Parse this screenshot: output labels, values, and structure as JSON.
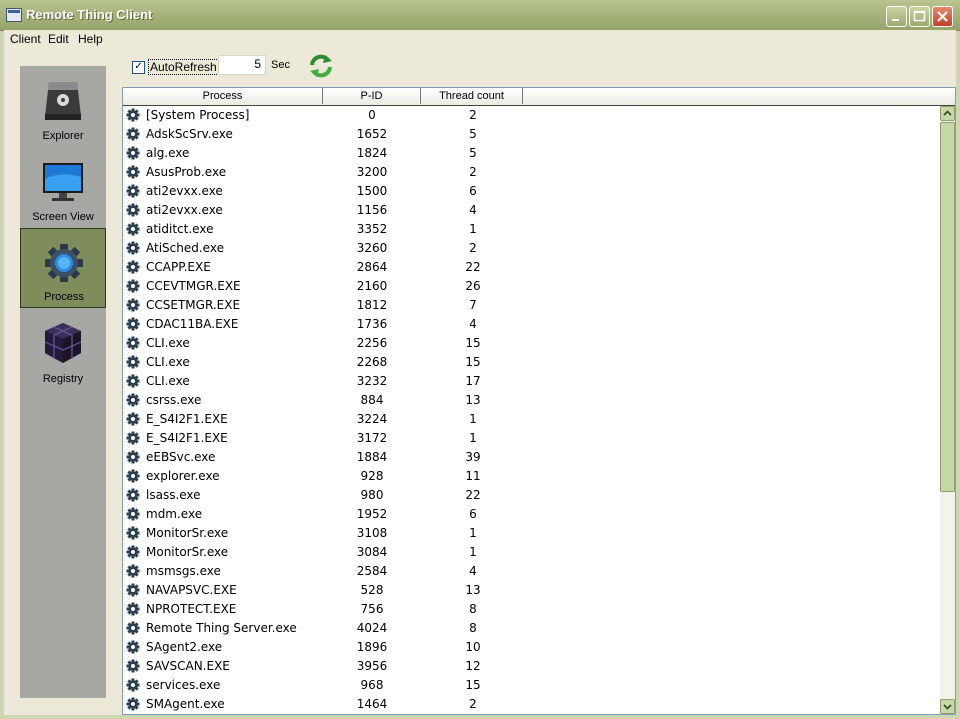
{
  "window": {
    "title": "Remote Thing Client"
  },
  "menu": {
    "items": [
      "Client",
      "Edit",
      "Help"
    ]
  },
  "sidebar": {
    "items": [
      {
        "label": "Explorer",
        "icon": "hard-drive-icon",
        "active": false
      },
      {
        "label": "Screen View",
        "icon": "monitor-icon",
        "active": false
      },
      {
        "label": "Process",
        "icon": "gear-icon",
        "active": true
      },
      {
        "label": "Registry",
        "icon": "registry-cube-icon",
        "active": false
      }
    ]
  },
  "toolbar": {
    "autorefresh_label": "AutoRefresh",
    "autorefresh_checked": true,
    "interval_value": "5",
    "interval_unit": "Sec",
    "refresh_icon": "refresh-icon"
  },
  "table": {
    "columns": [
      "Process",
      "P-ID",
      "Thread count"
    ],
    "rows": [
      [
        "[System Process]",
        "0",
        "2"
      ],
      [
        "AdskScSrv.exe",
        "1652",
        "5"
      ],
      [
        "alg.exe",
        "1824",
        "5"
      ],
      [
        "AsusProb.exe",
        "3200",
        "2"
      ],
      [
        "ati2evxx.exe",
        "1500",
        "6"
      ],
      [
        "ati2evxx.exe",
        "1156",
        "4"
      ],
      [
        "atiditct.exe",
        "3352",
        "1"
      ],
      [
        "AtiSched.exe",
        "3260",
        "2"
      ],
      [
        "CCAPP.EXE",
        "2864",
        "22"
      ],
      [
        "CCEVTMGR.EXE",
        "2160",
        "26"
      ],
      [
        "CCSETMGR.EXE",
        "1812",
        "7"
      ],
      [
        "CDAC11BA.EXE",
        "1736",
        "4"
      ],
      [
        "CLI.exe",
        "2256",
        "15"
      ],
      [
        "CLI.exe",
        "2268",
        "15"
      ],
      [
        "CLI.exe",
        "3232",
        "17"
      ],
      [
        "csrss.exe",
        "884",
        "13"
      ],
      [
        "E_S4I2F1.EXE",
        "3224",
        "1"
      ],
      [
        "E_S4I2F1.EXE",
        "3172",
        "1"
      ],
      [
        "eEBSvc.exe",
        "1884",
        "39"
      ],
      [
        "explorer.exe",
        "928",
        "11"
      ],
      [
        "lsass.exe",
        "980",
        "22"
      ],
      [
        "mdm.exe",
        "1952",
        "6"
      ],
      [
        "MonitorSr.exe",
        "3108",
        "1"
      ],
      [
        "MonitorSr.exe",
        "3084",
        "1"
      ],
      [
        "msmsgs.exe",
        "2584",
        "4"
      ],
      [
        "NAVAPSVC.EXE",
        "528",
        "13"
      ],
      [
        "NPROTECT.EXE",
        "756",
        "8"
      ],
      [
        "Remote Thing Server.exe",
        "4024",
        "8"
      ],
      [
        "SAgent2.exe",
        "1896",
        "10"
      ],
      [
        "SAVSCAN.EXE",
        "3956",
        "12"
      ],
      [
        "services.exe",
        "968",
        "15"
      ],
      [
        "SMAgent.exe",
        "1464",
        "2"
      ]
    ]
  },
  "colors": {
    "window_frame": "#cfd6b3",
    "sidebar_bg": "#a7a7a3",
    "active_nav": "#7f8c5c"
  }
}
